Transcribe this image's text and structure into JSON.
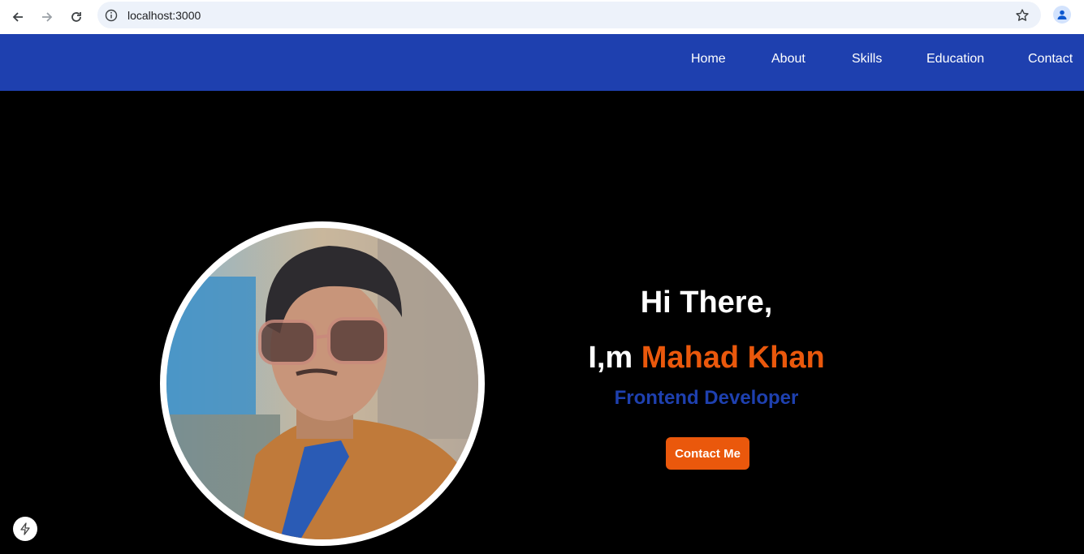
{
  "browser": {
    "url": "localhost:3000",
    "icons": [
      "back-arrow-icon",
      "forward-arrow-icon",
      "reload-icon",
      "info-icon",
      "bookmark-star-icon",
      "profile-icon"
    ]
  },
  "nav": {
    "items": [
      {
        "label": "Home"
      },
      {
        "label": "About"
      },
      {
        "label": "Skills"
      },
      {
        "label": "Education"
      },
      {
        "label": "Contact"
      }
    ]
  },
  "hero": {
    "greeting": "Hi There,",
    "name_prefix": "I,m",
    "name": "Mahad Khan",
    "role": "Frontend Developer",
    "cta_label": "Contact Me"
  },
  "colors": {
    "nav_bg": "#1e40af",
    "accent": "#ea580c",
    "role_text": "#1e40af",
    "hero_bg": "#000000"
  }
}
